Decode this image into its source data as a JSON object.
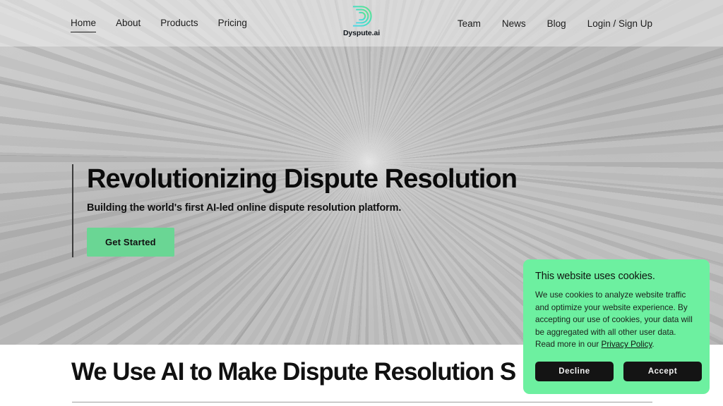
{
  "brand": {
    "name": "Dyspute.ai",
    "logo_icon": "spiral-d-logo-icon",
    "gradient_start": "#3bd4f0",
    "gradient_end": "#5fe08a"
  },
  "header": {
    "nav_left": [
      {
        "label": "Home",
        "active": true
      },
      {
        "label": "About",
        "active": false
      },
      {
        "label": "Products",
        "active": false
      },
      {
        "label": "Pricing",
        "active": false
      }
    ],
    "nav_right": [
      {
        "label": "Team"
      },
      {
        "label": "News"
      },
      {
        "label": "Blog"
      },
      {
        "label": "Login / Sign Up"
      }
    ]
  },
  "hero": {
    "title": "Revolutionizing Dispute Resolution",
    "subtitle": "Building the world's first AI-led online dispute resolution platform.",
    "cta_label": "Get Started",
    "cta_color": "#6ad694"
  },
  "section": {
    "title": "We Use AI to Make Dispute Resolution S"
  },
  "cookie_banner": {
    "title": "This website uses cookies.",
    "body_part1": "We use cookies to analyze website traffic and optimize your website experience. By accepting our use of cookies, your data will be aggregated with all other user data. Read more in our ",
    "link_label": "Privacy Policy",
    "body_part2": ".",
    "decline_label": "Decline",
    "accept_label": "Accept",
    "background_color": "#6df0a0",
    "button_color": "#141414"
  }
}
